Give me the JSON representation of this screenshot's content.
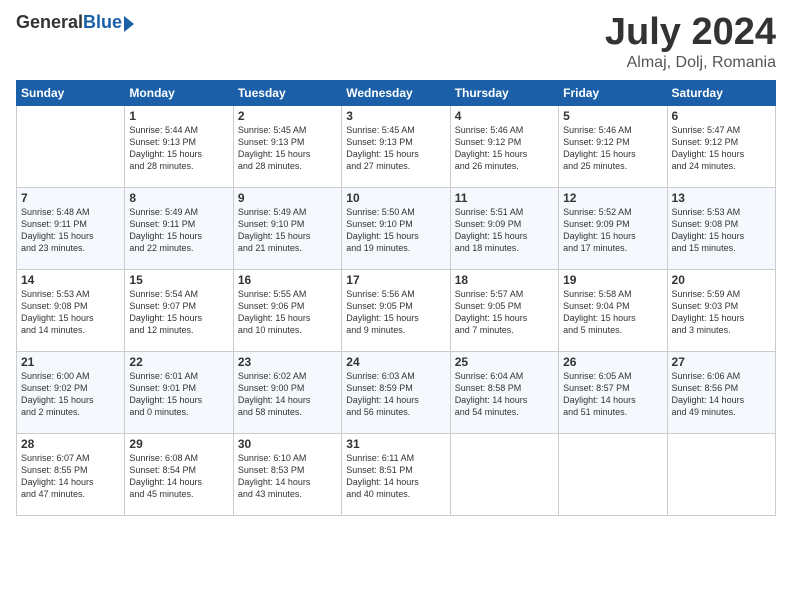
{
  "header": {
    "logo_general": "General",
    "logo_blue": "Blue",
    "title": "July 2024",
    "location": "Almaj, Dolj, Romania"
  },
  "days_of_week": [
    "Sunday",
    "Monday",
    "Tuesday",
    "Wednesday",
    "Thursday",
    "Friday",
    "Saturday"
  ],
  "weeks": [
    [
      {
        "day": "",
        "lines": []
      },
      {
        "day": "1",
        "lines": [
          "Sunrise: 5:44 AM",
          "Sunset: 9:13 PM",
          "Daylight: 15 hours",
          "and 28 minutes."
        ]
      },
      {
        "day": "2",
        "lines": [
          "Sunrise: 5:45 AM",
          "Sunset: 9:13 PM",
          "Daylight: 15 hours",
          "and 28 minutes."
        ]
      },
      {
        "day": "3",
        "lines": [
          "Sunrise: 5:45 AM",
          "Sunset: 9:13 PM",
          "Daylight: 15 hours",
          "and 27 minutes."
        ]
      },
      {
        "day": "4",
        "lines": [
          "Sunrise: 5:46 AM",
          "Sunset: 9:12 PM",
          "Daylight: 15 hours",
          "and 26 minutes."
        ]
      },
      {
        "day": "5",
        "lines": [
          "Sunrise: 5:46 AM",
          "Sunset: 9:12 PM",
          "Daylight: 15 hours",
          "and 25 minutes."
        ]
      },
      {
        "day": "6",
        "lines": [
          "Sunrise: 5:47 AM",
          "Sunset: 9:12 PM",
          "Daylight: 15 hours",
          "and 24 minutes."
        ]
      }
    ],
    [
      {
        "day": "7",
        "lines": [
          "Sunrise: 5:48 AM",
          "Sunset: 9:11 PM",
          "Daylight: 15 hours",
          "and 23 minutes."
        ]
      },
      {
        "day": "8",
        "lines": [
          "Sunrise: 5:49 AM",
          "Sunset: 9:11 PM",
          "Daylight: 15 hours",
          "and 22 minutes."
        ]
      },
      {
        "day": "9",
        "lines": [
          "Sunrise: 5:49 AM",
          "Sunset: 9:10 PM",
          "Daylight: 15 hours",
          "and 21 minutes."
        ]
      },
      {
        "day": "10",
        "lines": [
          "Sunrise: 5:50 AM",
          "Sunset: 9:10 PM",
          "Daylight: 15 hours",
          "and 19 minutes."
        ]
      },
      {
        "day": "11",
        "lines": [
          "Sunrise: 5:51 AM",
          "Sunset: 9:09 PM",
          "Daylight: 15 hours",
          "and 18 minutes."
        ]
      },
      {
        "day": "12",
        "lines": [
          "Sunrise: 5:52 AM",
          "Sunset: 9:09 PM",
          "Daylight: 15 hours",
          "and 17 minutes."
        ]
      },
      {
        "day": "13",
        "lines": [
          "Sunrise: 5:53 AM",
          "Sunset: 9:08 PM",
          "Daylight: 15 hours",
          "and 15 minutes."
        ]
      }
    ],
    [
      {
        "day": "14",
        "lines": [
          "Sunrise: 5:53 AM",
          "Sunset: 9:08 PM",
          "Daylight: 15 hours",
          "and 14 minutes."
        ]
      },
      {
        "day": "15",
        "lines": [
          "Sunrise: 5:54 AM",
          "Sunset: 9:07 PM",
          "Daylight: 15 hours",
          "and 12 minutes."
        ]
      },
      {
        "day": "16",
        "lines": [
          "Sunrise: 5:55 AM",
          "Sunset: 9:06 PM",
          "Daylight: 15 hours",
          "and 10 minutes."
        ]
      },
      {
        "day": "17",
        "lines": [
          "Sunrise: 5:56 AM",
          "Sunset: 9:05 PM",
          "Daylight: 15 hours",
          "and 9 minutes."
        ]
      },
      {
        "day": "18",
        "lines": [
          "Sunrise: 5:57 AM",
          "Sunset: 9:05 PM",
          "Daylight: 15 hours",
          "and 7 minutes."
        ]
      },
      {
        "day": "19",
        "lines": [
          "Sunrise: 5:58 AM",
          "Sunset: 9:04 PM",
          "Daylight: 15 hours",
          "and 5 minutes."
        ]
      },
      {
        "day": "20",
        "lines": [
          "Sunrise: 5:59 AM",
          "Sunset: 9:03 PM",
          "Daylight: 15 hours",
          "and 3 minutes."
        ]
      }
    ],
    [
      {
        "day": "21",
        "lines": [
          "Sunrise: 6:00 AM",
          "Sunset: 9:02 PM",
          "Daylight: 15 hours",
          "and 2 minutes."
        ]
      },
      {
        "day": "22",
        "lines": [
          "Sunrise: 6:01 AM",
          "Sunset: 9:01 PM",
          "Daylight: 15 hours",
          "and 0 minutes."
        ]
      },
      {
        "day": "23",
        "lines": [
          "Sunrise: 6:02 AM",
          "Sunset: 9:00 PM",
          "Daylight: 14 hours",
          "and 58 minutes."
        ]
      },
      {
        "day": "24",
        "lines": [
          "Sunrise: 6:03 AM",
          "Sunset: 8:59 PM",
          "Daylight: 14 hours",
          "and 56 minutes."
        ]
      },
      {
        "day": "25",
        "lines": [
          "Sunrise: 6:04 AM",
          "Sunset: 8:58 PM",
          "Daylight: 14 hours",
          "and 54 minutes."
        ]
      },
      {
        "day": "26",
        "lines": [
          "Sunrise: 6:05 AM",
          "Sunset: 8:57 PM",
          "Daylight: 14 hours",
          "and 51 minutes."
        ]
      },
      {
        "day": "27",
        "lines": [
          "Sunrise: 6:06 AM",
          "Sunset: 8:56 PM",
          "Daylight: 14 hours",
          "and 49 minutes."
        ]
      }
    ],
    [
      {
        "day": "28",
        "lines": [
          "Sunrise: 6:07 AM",
          "Sunset: 8:55 PM",
          "Daylight: 14 hours",
          "and 47 minutes."
        ]
      },
      {
        "day": "29",
        "lines": [
          "Sunrise: 6:08 AM",
          "Sunset: 8:54 PM",
          "Daylight: 14 hours",
          "and 45 minutes."
        ]
      },
      {
        "day": "30",
        "lines": [
          "Sunrise: 6:10 AM",
          "Sunset: 8:53 PM",
          "Daylight: 14 hours",
          "and 43 minutes."
        ]
      },
      {
        "day": "31",
        "lines": [
          "Sunrise: 6:11 AM",
          "Sunset: 8:51 PM",
          "Daylight: 14 hours",
          "and 40 minutes."
        ]
      },
      {
        "day": "",
        "lines": []
      },
      {
        "day": "",
        "lines": []
      },
      {
        "day": "",
        "lines": []
      }
    ]
  ]
}
